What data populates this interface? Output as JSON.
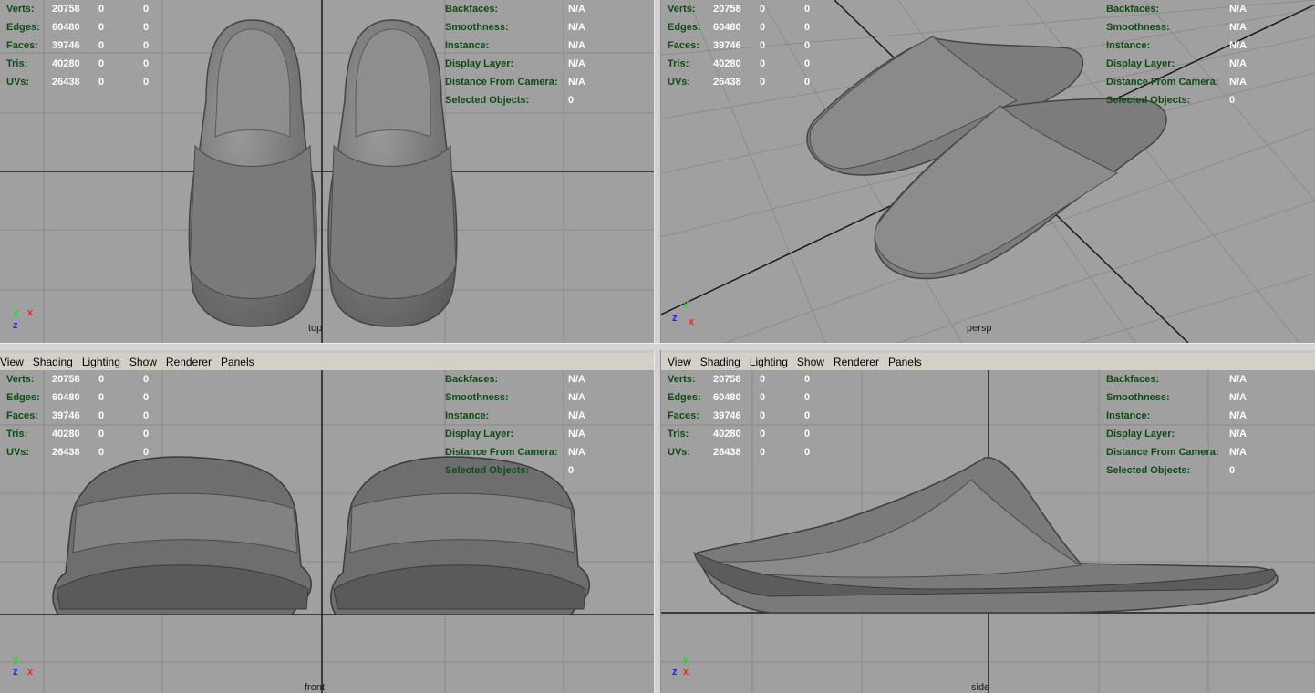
{
  "menu": [
    "View",
    "Shading",
    "Lighting",
    "Show",
    "Renderer",
    "Panels"
  ],
  "hud_left": [
    {
      "label": "Verts:",
      "values": [
        "20758",
        "0",
        "0"
      ]
    },
    {
      "label": "Edges:",
      "values": [
        "60480",
        "0",
        "0"
      ]
    },
    {
      "label": "Faces:",
      "values": [
        "39746",
        "0",
        "0"
      ]
    },
    {
      "label": "Tris:",
      "values": [
        "40280",
        "0",
        "0"
      ]
    },
    {
      "label": "UVs:",
      "values": [
        "26438",
        "0",
        "0"
      ]
    }
  ],
  "hud_right": [
    {
      "label": "Backfaces:",
      "value": "N/A"
    },
    {
      "label": "Smoothness:",
      "value": "N/A"
    },
    {
      "label": "Instance:",
      "value": "N/A"
    },
    {
      "label": "Display Layer:",
      "value": "N/A"
    },
    {
      "label": "Distance From Camera:",
      "value": "N/A"
    },
    {
      "label": "Selected Objects:",
      "value": "0"
    }
  ],
  "viewports": {
    "top": {
      "camera": "top"
    },
    "persp": {
      "camera": "persp"
    },
    "front": {
      "camera": "front"
    },
    "side": {
      "camera": "side"
    }
  },
  "axes": {
    "x": "x",
    "y": "y",
    "z": "z"
  },
  "colors": {
    "viewport_bg": "#a0a0a0",
    "grid": "#8a8a8a",
    "grid_axis": "#1a1a1a",
    "hud_label": "#0c4d15",
    "hud_value": "#ffffff",
    "axis_x": "#ff2020",
    "axis_y": "#20e020",
    "axis_z": "#2020ff"
  }
}
